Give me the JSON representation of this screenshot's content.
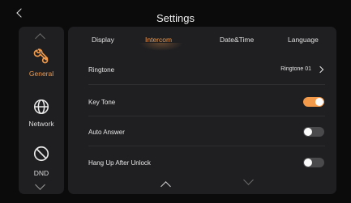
{
  "header": {
    "title": "Settings",
    "back_icon": "chevron-left-icon"
  },
  "sidebar": {
    "scroll_up_icon": "chevron-up-icon",
    "scroll_down_icon": "chevron-down-icon",
    "items": [
      {
        "label": "General",
        "icon": "wrench-gear-icon",
        "active": true
      },
      {
        "label": "Network",
        "icon": "globe-icon",
        "active": false
      },
      {
        "label": "DND",
        "icon": "do-not-disturb-icon",
        "active": false
      }
    ]
  },
  "tabs": [
    {
      "label": "Display",
      "active": false
    },
    {
      "label": "Intercom",
      "active": true
    },
    {
      "label": "Date&Time",
      "active": false
    },
    {
      "label": "Language",
      "active": false
    }
  ],
  "settings": {
    "ringtone": {
      "label": "Ringtone",
      "value": "Ringtone 01"
    },
    "key_tone": {
      "label": "Key Tone",
      "enabled": true
    },
    "auto_answer": {
      "label": "Auto Answer",
      "enabled": false
    },
    "hang_up_after_unlock": {
      "label": "Hang Up After Unlock",
      "enabled": false
    }
  },
  "colors": {
    "accent": "#f29a4a",
    "panel": "#1f1f22",
    "background": "#0b0b0c",
    "toggle_off": "#4a4a4d"
  }
}
